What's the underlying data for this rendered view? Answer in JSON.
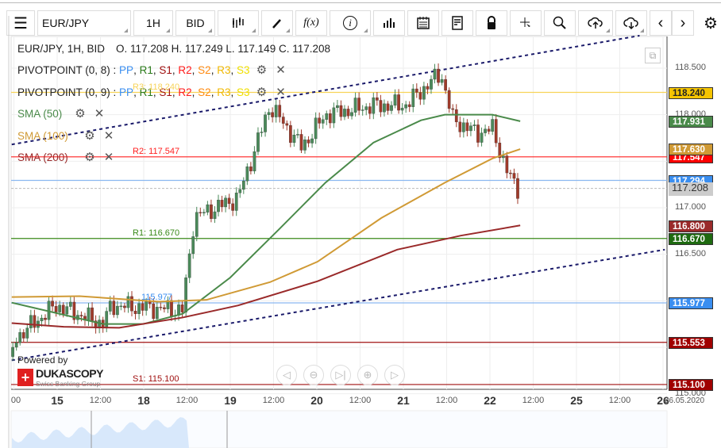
{
  "toolbar": {
    "instrument": "EUR/JPY",
    "period": "1H",
    "side": "BID",
    "fx_label": "f(x)"
  },
  "header": {
    "title": "EUR/JPY, 1H, BID",
    "ohlc": "O. 117.208 H. 117.249 L. 117.149 C. 117.208"
  },
  "indicators": [
    {
      "name": "PIVOTPOINT (0, 8)",
      "sep": " : "
    },
    {
      "name": "PIVOTPOINT (0, 9)",
      "sep": " : "
    },
    {
      "name": "SMA (50)",
      "color": "#4a8a4a"
    },
    {
      "name": "SMA (100)",
      "color": "#d09a35"
    },
    {
      "name": "SMA (200)",
      "color": "#9a2a2a"
    }
  ],
  "pivot_parts": [
    {
      "t": "PP",
      "c": "#3a8ef0"
    },
    {
      "t": "R1",
      "c": "#2a7a1a"
    },
    {
      "t": "S1",
      "c": "#a01010"
    },
    {
      "t": "R2",
      "c": "#ff1a1a"
    },
    {
      "t": "S2",
      "c": "#ff8a10"
    },
    {
      "t": "R3",
      "c": "#f0b800"
    },
    {
      "t": "S3",
      "c": "#f0e000"
    }
  ],
  "levels": [
    {
      "label": "118.240",
      "price": 118.24,
      "color": "#f7d358",
      "tagColor": "#f5c400",
      "tagText": "#222",
      "chartLabel": "R3: 118.240"
    },
    {
      "label": "117.547",
      "price": 117.547,
      "color": "#ff2020",
      "tagColor": "#ff0000",
      "tagText": "#fff",
      "chartLabel": "R2: 117.547"
    },
    {
      "label": "117.294",
      "price": 117.294,
      "color": "#8ab8f0",
      "tagColor": "#3a8ef0",
      "tagText": "#fff",
      "chartLabel": ""
    },
    {
      "label": "116.670",
      "price": 116.67,
      "color": "#3a8a1a",
      "tagColor": "#1e6a10",
      "tagText": "#fff",
      "chartLabel": "R1: 116.670"
    },
    {
      "label": "115.977",
      "price": 115.977,
      "color": "#8ab8f0",
      "tagColor": "#3a8ef0",
      "tagText": "#fff",
      "chartLabel": "115.977"
    },
    {
      "label": "115.553",
      "price": 115.553,
      "color": "#a01010",
      "tagColor": "#a00000",
      "tagText": "#fff",
      "chartLabel": ""
    },
    {
      "label": "115.100",
      "price": 115.1,
      "color": "#a01010",
      "tagColor": "#a00000",
      "tagText": "#fff",
      "chartLabel": "S1: 115.100"
    }
  ],
  "sma_tags": [
    {
      "label": "117.931",
      "price": 117.931,
      "color": "#4a8a4a"
    },
    {
      "label": "117.630",
      "price": 117.63,
      "color": "#d09a35"
    },
    {
      "label": "116.800",
      "price": 116.8,
      "color": "#9a2a2a"
    }
  ],
  "current_price": {
    "label": "117.208",
    "price": 117.208
  },
  "price_axis": [
    {
      "label": "118.500",
      "price": 118.5
    },
    {
      "label": "118.000",
      "price": 118.0
    },
    {
      "label": "117.000",
      "price": 117.0
    },
    {
      "label": "116.500",
      "price": 116.5
    },
    {
      "label": "115.500",
      "price": 115.5
    },
    {
      "label": "115.000",
      "price": 115.0
    }
  ],
  "time_axis": [
    {
      "label": "00",
      "h": -12,
      "day": false
    },
    {
      "label": "15",
      "h": 0,
      "day": true
    },
    {
      "label": "12:00",
      "h": 12,
      "day": false
    },
    {
      "label": "18",
      "h": 24,
      "day": true
    },
    {
      "label": "12:00",
      "h": 36,
      "day": false
    },
    {
      "label": "19",
      "h": 48,
      "day": true
    },
    {
      "label": "12:00",
      "h": 60,
      "day": false
    },
    {
      "label": "20",
      "h": 72,
      "day": true
    },
    {
      "label": "12:00",
      "h": 84,
      "day": false
    },
    {
      "label": "21",
      "h": 96,
      "day": true
    },
    {
      "label": "12:00",
      "h": 108,
      "day": false
    },
    {
      "label": "22",
      "h": 120,
      "day": true
    },
    {
      "label": "12:00",
      "h": 132,
      "day": false
    },
    {
      "label": "25",
      "h": 144,
      "day": true
    },
    {
      "label": "12:00",
      "h": 156,
      "day": false
    },
    {
      "label": "26",
      "h": 168,
      "day": true
    }
  ],
  "date_stamp": "26.05.2020",
  "logo": {
    "powered": "Powered by",
    "brand": "DUKASCOPY",
    "sub": "Swiss Banking Group"
  },
  "chart_data": {
    "type": "candlestick",
    "price_path": [
      [
        -12.6,
        115.4
      ],
      [
        -11.5,
        115.6
      ],
      [
        -0.4,
        115.95
      ],
      [
        12.8,
        115.75
      ],
      [
        15,
        115.95
      ],
      [
        34.8,
        115.9
      ],
      [
        38,
        116.9
      ],
      [
        50,
        117.1
      ],
      [
        54.6,
        117.6
      ],
      [
        59,
        118.1
      ],
      [
        67.8,
        117.65
      ],
      [
        74.4,
        118.0
      ],
      [
        87.7,
        118.1
      ],
      [
        96.5,
        118.1
      ],
      [
        106.4,
        118.45
      ],
      [
        109.7,
        117.95
      ],
      [
        116.3,
        117.8
      ],
      [
        120.7,
        117.85
      ],
      [
        125.1,
        117.35
      ],
      [
        127.8,
        117.21
      ]
    ],
    "sma50": [
      [
        -12.6,
        115.98
      ],
      [
        12.8,
        115.75
      ],
      [
        23.8,
        115.75
      ],
      [
        34.8,
        115.86
      ],
      [
        48,
        116.25
      ],
      [
        61.3,
        116.76
      ],
      [
        74.4,
        117.27
      ],
      [
        87.7,
        117.7
      ],
      [
        100.9,
        117.94
      ],
      [
        107.5,
        118.0
      ],
      [
        120.7,
        118.0
      ],
      [
        128.4,
        117.93
      ]
    ],
    "sma100": [
      [
        -12.6,
        116.04
      ],
      [
        6.2,
        116.05
      ],
      [
        28.2,
        115.99
      ],
      [
        41.4,
        116.01
      ],
      [
        59,
        116.2
      ],
      [
        72.2,
        116.42
      ],
      [
        89.9,
        116.89
      ],
      [
        107.5,
        117.27
      ],
      [
        120.7,
        117.53
      ],
      [
        128.4,
        117.63
      ]
    ],
    "sma200": [
      [
        -12.6,
        115.76
      ],
      [
        1.8,
        115.72
      ],
      [
        17.2,
        115.71
      ],
      [
        34.8,
        115.82
      ],
      [
        50.2,
        115.95
      ],
      [
        72.2,
        116.21
      ],
      [
        94.3,
        116.55
      ],
      [
        111.9,
        116.7
      ],
      [
        128.4,
        116.81
      ]
    ],
    "trend_upper": [
      [
        -12.6,
        117.68
      ],
      [
        161.5,
        118.85
      ]
    ],
    "trend_lower": [
      [
        -12.6,
        115.36
      ],
      [
        168.5,
        116.55
      ]
    ],
    "colors": {
      "up": "#4a8a5a",
      "down": "#a03a2a",
      "trend": "#1a1a6a"
    }
  }
}
